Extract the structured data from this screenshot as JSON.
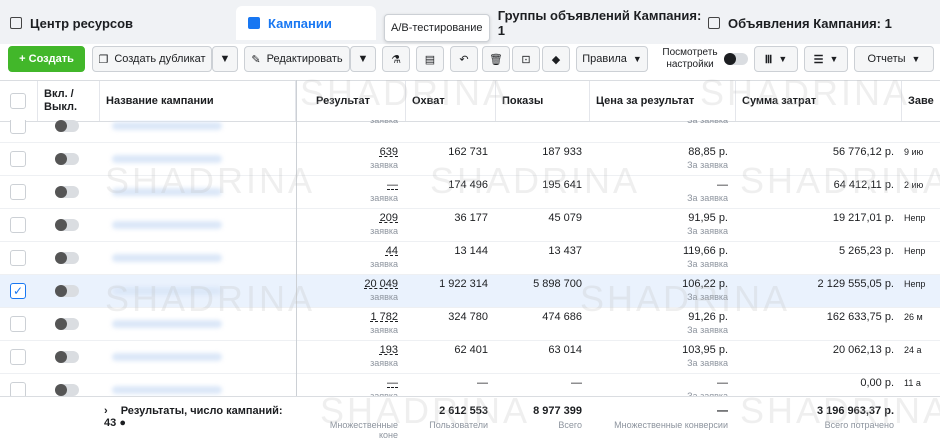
{
  "tabs": {
    "resources": "Центр ресурсов",
    "campaigns": "Кампании",
    "adsets": "Группы объявлений Кампания: 1",
    "ads": "Объявления Кампания: 1"
  },
  "tooltip": "A/B-тестирование",
  "toolbar": {
    "create": "+ Создать",
    "duplicate": "Создать дубликат",
    "edit": "Редактировать",
    "rules": "Правила",
    "view_settings_1": "Посмотреть",
    "view_settings_2": "настройки",
    "reports": "Отчеты"
  },
  "columns": {
    "onoff": "Вкл. / Выкл.",
    "name": "Название кампании",
    "result": "Результат",
    "reach": "Охват",
    "impressions": "Показы",
    "cpr": "Цена за результат",
    "spend": "Сумма затрат",
    "end": "Заве"
  },
  "rows": [
    {
      "result": "",
      "result_sub": "заявка",
      "reach": "",
      "impr": "",
      "cpr": "",
      "cpr_sub": "За заявка",
      "spend": "",
      "end": "",
      "checked": false
    },
    {
      "result": "639",
      "result_sub": "заявка",
      "reach": "162 731",
      "impr": "187 933",
      "cpr": "88,85 р.",
      "cpr_sub": "За заявка",
      "spend": "56 776,12 р.",
      "end": "9 ию",
      "checked": false
    },
    {
      "result": "—",
      "result_sub": "заявка",
      "reach": "174 496",
      "impr": "195 641",
      "cpr": "—",
      "cpr_sub": "За заявка",
      "spend": "64 412,11 р.",
      "end": "2 ию",
      "checked": false
    },
    {
      "result": "209",
      "result_sub": "заявка",
      "reach": "36 177",
      "impr": "45 079",
      "cpr": "91,95 р.",
      "cpr_sub": "За заявка",
      "spend": "19 217,01 р.",
      "end": "Непр",
      "checked": false
    },
    {
      "result": "44",
      "result_sub": "заявка",
      "reach": "13 144",
      "impr": "13 437",
      "cpr": "119,66 р.",
      "cpr_sub": "За заявка",
      "spend": "5 265,23 р.",
      "end": "Непр",
      "checked": false
    },
    {
      "result": "20 049",
      "result_sub": "заявка",
      "reach": "1 922 314",
      "impr": "5 898 700",
      "cpr": "106,22 р.",
      "cpr_sub": "За заявка",
      "spend": "2 129 555,05 р.",
      "end": "Непр",
      "checked": true
    },
    {
      "result": "1 782",
      "result_sub": "заявка",
      "reach": "324 780",
      "impr": "474 686",
      "cpr": "91,26 р.",
      "cpr_sub": "За заявка",
      "spend": "162 633,75 р.",
      "end": "26 м",
      "checked": false
    },
    {
      "result": "193",
      "result_sub": "заявка",
      "reach": "62 401",
      "impr": "63 014",
      "cpr": "103,95 р.",
      "cpr_sub": "За заявка",
      "spend": "20 062,13 р.",
      "end": "24 а",
      "checked": false
    },
    {
      "result": "—",
      "result_sub": "заявка",
      "reach": "—",
      "impr": "—",
      "cpr": "—",
      "cpr_sub": "За заявка",
      "spend": "0,00 р.",
      "end": "11 а",
      "checked": false
    }
  ],
  "footer": {
    "label": "Результаты, число кампаний: 43",
    "result_sub": "Множественные коне",
    "reach": "2 612 553",
    "reach_sub": "Пользователи",
    "impr": "8 977 399",
    "impr_sub": "Всего",
    "cpr": "—",
    "cpr_sub": "Множественные конверсии",
    "spend": "3 196 963,37 р.",
    "spend_sub": "Всего потрачено"
  },
  "watermark": "SHADRINA"
}
